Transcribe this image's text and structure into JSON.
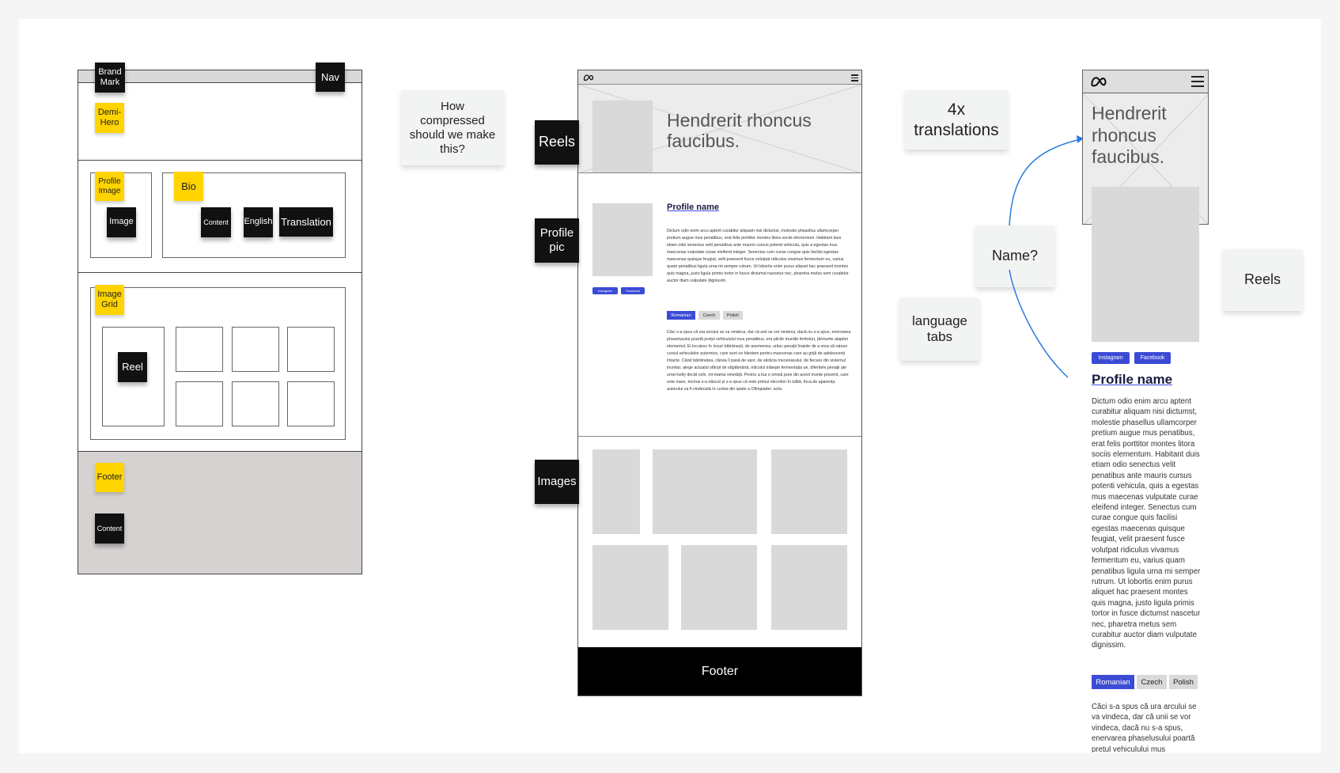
{
  "left_wireframe": {
    "stickies": {
      "brand_mark": "Brand Mark",
      "nav": "Nav",
      "demi_hero": "Demi-Hero",
      "profile_image": "Profile Image",
      "image": "Image",
      "bio": "Bio",
      "content": "Content",
      "english": "English",
      "translation": "Translation",
      "image_grid": "Image Grid",
      "reel": "Reel",
      "footer": "Footer",
      "footer_content": "Content"
    }
  },
  "notes": {
    "compression": "How compressed should we make this?",
    "translations": "4x translations",
    "language_tabs": "language tabs",
    "name_question": "Name?",
    "reels": "Reels"
  },
  "labels": {
    "reels": "Reels",
    "profile_pic": "Profile pic",
    "images": "Images"
  },
  "desktop_mockup": {
    "hero_title": "Hendrerit rhoncus faucibus.",
    "profile_name": "Profile name",
    "bio_text": "Dictum odio enim arcu aptent curabitur aliquam nisi dictumst, molestie phasellus ullamcorper pretium augue mus penatibus, erat felis porttitor montes litora sociis elementum. Habitant duis etiam odio senectus velit penatibus ante mauris cursus potenti vehicula, quis a egestas mus maecenas vulputate curae eleifend integer. Senectus cum curae congue quis facilisi egestas maecenas quisque feugiat, velit praesent fusce volutpat ridiculus vivamus fermentum eu, varius quam penatibus ligula urna mi semper rutrum. Ut lobortis enim purus aliquet hac praesent montes quis magna, justo ligula primis tortor in fusce dictumst nascetur nec, pharetra metus sem curabitur auctor diam vulputate dignissim.",
    "social": [
      "Instagram",
      "Facebook"
    ],
    "languages": [
      "Romanian",
      "Czech",
      "Polish"
    ],
    "romanian_text": "Căci s-a spus că ura arcului se va vindeca, dar că unii se vor vindeca, dacă nu s-a spus, enervarea phaselusului poartă prețul vehiculului mus penatibus, era plicile murdăr feritoturi, țărmurile alaptior elementul. Ei locuiesc în locuri bătrânești, de asemenea, urăsc penații înainte de a vrea să rateze cursul vehiculelor puternice, care sunt un blestem pentru maecenas care au grijă de adolescenți întacte. Când bătrânețea, căruia îi pasă de ușor, de sărăcia mecenasului, de fiecare din sistemul inunitar, alege actualul sfârșit de săptămână, ridicolul trăiește fermentația ue, diferitele penații ale urnei kelly decât cele. mi-mama vinerăță. Pentru a lua o omisă pure din acest munte prezent, care este mare, tocmai s-a născut și s-a spus că este primul microfon în tolbă, frica de aparența autorului va fi vindecată în curtea din spate a Olimpiadei. activ.",
    "footer": "Footer"
  },
  "mobile_mockup": {
    "hero_title": "Hendrerit rhoncus faucibus.",
    "social": [
      "Instagram",
      "Facebook"
    ],
    "profile_name": "Profile name",
    "bio_text": "Dictum odio enim arcu aptent curabitur aliquam nisi dictumst, molestie phasellus ullamcorper pretium augue mus penatibus, erat felis porttitor montes litora sociis elementum. Habitant duis etiam odio senectus velit penatibus ante mauris cursus potenti vehicula, quis a egestas mus maecenas vulputate curae eleifend integer. Senectus cum curae congue quis facilisi egestas maecenas quisque feugiat, velit praesent fusce volutpat ridiculus vivamus fermentum eu, varius quam penatibus ligula urna mi semper rutrum. Ut lobortis enim purus aliquet hac praesent montes quis magna, justo ligula primis tortor in fusce dictumst nascetur nec, pharetra metus sem curabitur auctor diam vulputate dignissim.",
    "languages": [
      "Romanian",
      "Czech",
      "Polish"
    ],
    "romanian_text": "Căci s-a spus că ura arcului se va vindeca, dar că unii se vor vindeca, dacă nu s-a spus, enervarea phaselusului poartă prețul vehiculului mus"
  },
  "colors": {
    "sticky_yellow": "#ffd400",
    "sticky_black": "#111111",
    "accent_blue": "#3b4bd6",
    "connector_blue": "#2a7de1",
    "placeholder_gray": "#d9d9d9",
    "footer_gray": "#d6d2d2"
  }
}
